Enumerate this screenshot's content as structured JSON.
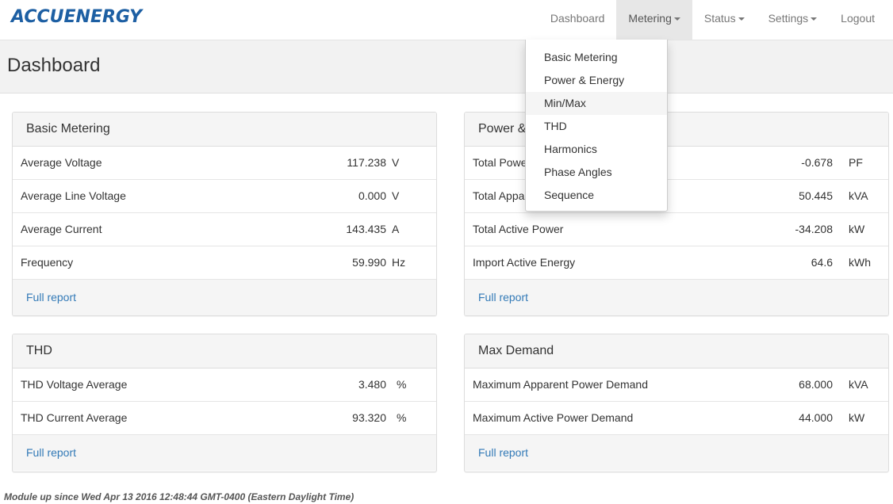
{
  "brand": {
    "logo_text": "ACCUENERGY",
    "color": "#1d5fa3"
  },
  "nav": {
    "items": [
      {
        "label": "Dashboard",
        "dropdown": false,
        "active": false
      },
      {
        "label": "Metering",
        "dropdown": true,
        "active": true
      },
      {
        "label": "Status",
        "dropdown": true,
        "active": false
      },
      {
        "label": "Settings",
        "dropdown": true,
        "active": false
      },
      {
        "label": "Logout",
        "dropdown": false,
        "active": false
      }
    ]
  },
  "metering_menu": {
    "items": [
      "Basic Metering",
      "Power & Energy",
      "Min/Max",
      "THD",
      "Harmonics",
      "Phase Angles",
      "Sequence"
    ],
    "highlighted": "Min/Max"
  },
  "page": {
    "title": "Dashboard"
  },
  "panels": {
    "basic_metering": {
      "title": "Basic Metering",
      "rows": [
        {
          "label": "Average Voltage",
          "value": "117.238",
          "unit": "V"
        },
        {
          "label": "Average Line Voltage",
          "value": "0.000",
          "unit": "V"
        },
        {
          "label": "Average Current",
          "value": "143.435",
          "unit": "A"
        },
        {
          "label": "Frequency",
          "value": "59.990",
          "unit": "Hz"
        }
      ],
      "footer_link": "Full report"
    },
    "power_energy": {
      "title": "Power & Energy",
      "rows": [
        {
          "label": "Total Power Factor",
          "value": "-0.678",
          "unit": "PF"
        },
        {
          "label": "Total Apparent Power",
          "value": "50.445",
          "unit": "kVA"
        },
        {
          "label": "Total Active Power",
          "value": "-34.208",
          "unit": "kW"
        },
        {
          "label": "Import Active Energy",
          "value": "64.6",
          "unit": "kWh"
        }
      ],
      "footer_link": "Full report"
    },
    "thd": {
      "title": "THD",
      "rows": [
        {
          "label": "THD Voltage Average",
          "value": "3.480",
          "unit": "%"
        },
        {
          "label": "THD Current Average",
          "value": "93.320",
          "unit": "%"
        }
      ],
      "footer_link": "Full report"
    },
    "max_demand": {
      "title": "Max Demand",
      "rows": [
        {
          "label": "Maximum Apparent Power Demand",
          "value": "68.000",
          "unit": "kVA"
        },
        {
          "label": "Maximum Active Power Demand",
          "value": "44.000",
          "unit": "kW"
        }
      ],
      "footer_link": "Full report"
    }
  },
  "footer": {
    "uptime_text": "Module up since Wed Apr 13 2016 12:48:44 GMT-0400 (Eastern Daylight Time)"
  }
}
